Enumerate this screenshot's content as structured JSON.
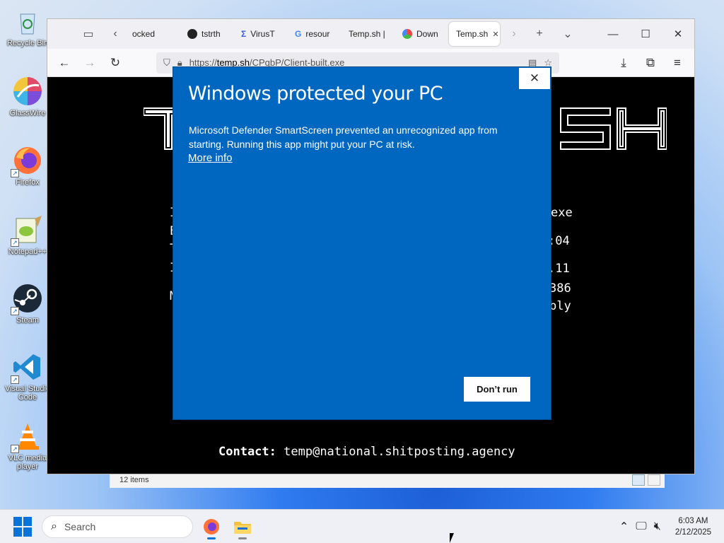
{
  "desktop": {
    "icons": [
      {
        "label": "Recycle Bin",
        "icon": "recycle-bin-icon"
      },
      {
        "label": "GlassWire",
        "icon": "glasswire-icon"
      },
      {
        "label": "Firefox",
        "icon": "firefox-icon"
      },
      {
        "label": "Notepad++",
        "icon": "notepad-plus-plus-icon"
      },
      {
        "label": "Steam",
        "icon": "steam-icon"
      },
      {
        "label": "Visual Studio Code",
        "icon": "vscode-icon"
      },
      {
        "label": "VLC media player",
        "icon": "vlc-icon"
      }
    ]
  },
  "explorer": {
    "status": "12 items"
  },
  "browser": {
    "tabs": [
      {
        "label": "ocked",
        "icon": "page-icon"
      },
      {
        "label": "tstrth",
        "icon": "github-icon"
      },
      {
        "label": "VirusT",
        "icon": "virustotal-icon"
      },
      {
        "label": "resour",
        "icon": "google-icon"
      },
      {
        "label": "Temp.sh |",
        "icon": "page-icon"
      },
      {
        "label": "Down",
        "icon": "download-site-icon"
      },
      {
        "label": "Temp.sh",
        "icon": "page-icon",
        "active": true
      }
    ],
    "url": {
      "prefix": "https://",
      "domain": "temp.sh",
      "path": "/CPqbP/Client-built.exe"
    },
    "page": {
      "fragments": [
        "exe",
        ":04",
        ".11",
        "386",
        "bly"
      ],
      "contact_label": "Contact:",
      "contact_email": "temp@national.shitposting.agency"
    }
  },
  "dialog": {
    "title": "Windows protected your PC",
    "message": "Microsoft Defender SmartScreen prevented an unrecognized app from starting. Running this app might put your PC at risk.",
    "more_info": "More info",
    "dont_run": "Don’t run",
    "close": "✕",
    "color": "#0067c0"
  },
  "taskbar": {
    "search_placeholder": "Search",
    "time": "6:03 AM",
    "date": "2/12/2025"
  }
}
